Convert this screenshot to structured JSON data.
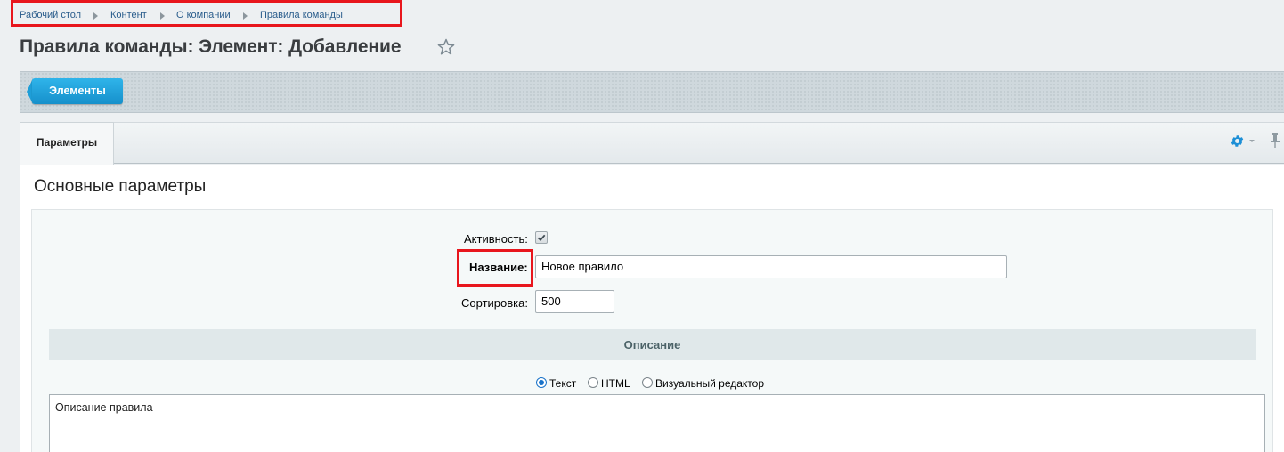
{
  "breadcrumb": {
    "items": [
      "Рабочий стол",
      "Контент",
      "О компании",
      "Правила команды"
    ]
  },
  "page": {
    "title": "Правила команды: Элемент: Добавление"
  },
  "toolbar": {
    "elements_button": "Элементы"
  },
  "tabs": [
    {
      "label": "Параметры",
      "active": true
    }
  ],
  "section": {
    "title": "Основные параметры"
  },
  "form": {
    "active_label": "Активность:",
    "active_checked": true,
    "name_label": "Название:",
    "name_value": "Новое правило",
    "sort_label": "Сортировка:",
    "sort_value": "500"
  },
  "description": {
    "header": "Описание",
    "modes": [
      "Текст",
      "HTML",
      "Визуальный редактор"
    ],
    "selected_mode": "Текст",
    "text": "Описание правила"
  },
  "colors": {
    "highlight": "#e8161d",
    "accent": "#1d9ad6",
    "link": "#2a5d8c"
  },
  "icons": [
    "chevron-right-icon",
    "star-icon",
    "gear-icon",
    "pin-icon",
    "checkmark-icon"
  ]
}
